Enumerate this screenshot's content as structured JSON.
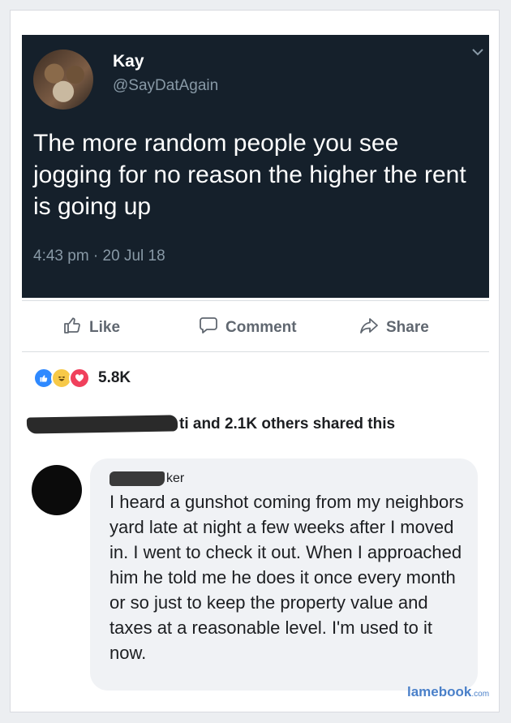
{
  "tweet": {
    "name": "Kay",
    "handle": "@SayDatAgain",
    "text": "The more random people you see jogging for no reason the higher the rent is going up",
    "time": "4:43 pm · 20 Jul 18",
    "colors": {
      "background": "#15202b",
      "secondary_text": "#8899a6"
    }
  },
  "actions": {
    "like_label": "Like",
    "comment_label": "Comment",
    "share_label": "Share"
  },
  "reactions": {
    "icons": [
      "like-icon",
      "haha-icon",
      "love-icon"
    ],
    "count": "5.8K"
  },
  "shared": {
    "name_suffix": "ti",
    "text": " and 2.1K others shared this"
  },
  "comment": {
    "author_suffix": "ker",
    "text": "I heard a gunshot coming from my neighbors yard late at night a few weeks after I moved in. I went to check it out. When I approached him he told me he does it once every month or so just to keep the property value and taxes at a reasonable level. I'm used to it now."
  },
  "watermark": {
    "brand": "lamebook",
    "domain": ".com"
  }
}
